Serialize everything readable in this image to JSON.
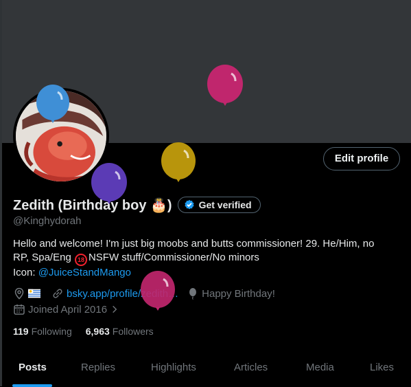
{
  "profile": {
    "display_name": "Zedith (Birthday boy 🎂)",
    "verify_label": "Get verified",
    "handle": "@Kinghydorah",
    "edit_label": "Edit profile",
    "bio": {
      "line1": "Hello and welcome! I'm just big moobs and butts commissioner!  29. He/Him, no",
      "line2_pre": "RP, Spa/Eng ",
      "line2_badge": "18",
      "line2_post": "NSFW stuff/Commissioner/No minors",
      "line3_pre": "Icon: ",
      "line3_link": "@JuiceStandMango"
    },
    "website": "bsky.app/profile/zedith…",
    "birthday_text": "Happy Birthday!",
    "joined": "Joined April 2016",
    "following_count": "119",
    "following_label": "Following",
    "followers_count": "6,963",
    "followers_label": "Followers"
  },
  "tabs": [
    "Posts",
    "Replies",
    "Highlights",
    "Articles",
    "Media",
    "Likes"
  ],
  "active_tab": "Posts",
  "colors": {
    "accent": "#1d9bf0",
    "background": "#000000",
    "banner": "#333639",
    "balloon_pink": "#c0266d",
    "balloon_gold": "#b8950c",
    "balloon_purple": "#5b3bb5",
    "balloon_blue": "#3f8fd6"
  }
}
